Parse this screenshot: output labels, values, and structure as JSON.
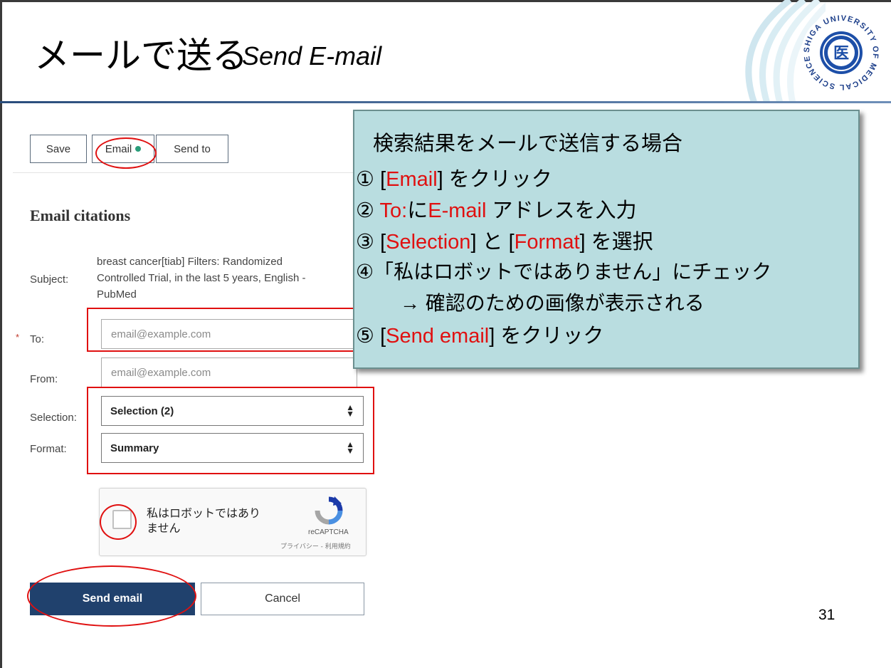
{
  "slide": {
    "title_jp": "メールで送る",
    "title_en": "Send E-mail",
    "page_number": "31",
    "logo_text": "SHIGA UNIVERSITY OF MEDICAL SCIENCE",
    "logo_mark": "医"
  },
  "toolbar": {
    "save_label": "Save",
    "email_label": "Email",
    "send_to_label": "Send to"
  },
  "form": {
    "heading": "Email citations",
    "subject_label": "Subject:",
    "subject_lines": [
      "breast cancer[tiab] Filters: Randomized",
      "Controlled Trial, in the last 5 years, English -",
      "PubMed"
    ],
    "required_mark": "*",
    "to_label": "To:",
    "to_placeholder": "email@example.com",
    "from_label": "From:",
    "from_placeholder": "email@example.com",
    "selection_label": "Selection:",
    "selection_value": "Selection (2)",
    "format_label": "Format:",
    "format_value": "Summary",
    "captcha_text_line1": "私はロボットではあり",
    "captcha_text_line2": "ません",
    "captcha_brand": "reCAPTCHA",
    "captcha_links": "プライバシー - 利用規約",
    "send_label": "Send email",
    "cancel_label": "Cancel"
  },
  "callout": {
    "title": "検索結果をメールで送信する場合",
    "step1_num": "①",
    "step1_open": "[",
    "step1_red": "Email",
    "step1_rest": "] をクリック",
    "step2_num": "②",
    "step2_red1": "To:",
    "step2_mid": "に",
    "step2_red2": "E-mail",
    "step2_rest": " アドレスを入力",
    "step3_num": "③",
    "step3_open": "[",
    "step3_red1": "Selection",
    "step3_mid": "] と [",
    "step3_red2": "Format",
    "step3_rest": "] を選択",
    "step4_num": "④",
    "step4_text": "「私はロボットではありません」にチェック",
    "step4_sub": "→ 確認のための画像が表示される",
    "step5_num": "⑤",
    "step5_open": "[",
    "step5_red": "Send email",
    "step5_rest": "] をクリック"
  },
  "colors": {
    "accent_red": "#e01010",
    "pubmed_blue": "#20416d",
    "callout_bg": "#b9dde0",
    "status_dot": "#2a9d7a"
  },
  "icons": {
    "captcha": "recaptcha-icon",
    "select_arrows": "sort-arrows-icon",
    "status": "green-dot-icon"
  }
}
